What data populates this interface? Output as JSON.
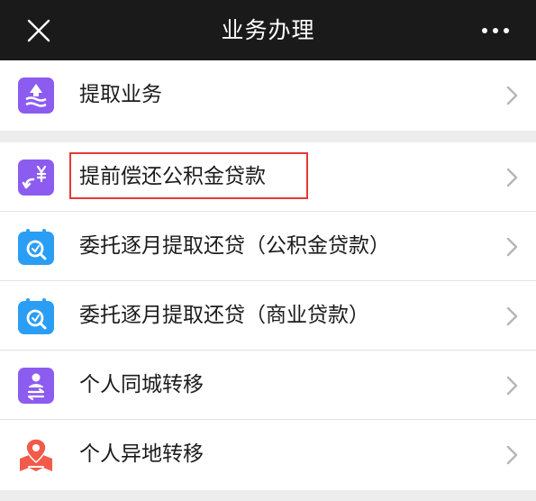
{
  "header": {
    "title": "业务办理"
  },
  "group1": [
    {
      "label": "提取业务",
      "icon": "withdraw-icon"
    }
  ],
  "group2": [
    {
      "label": "提前偿还公积金贷款",
      "icon": "loan-repay-icon"
    },
    {
      "label": "委托逐月提取还贷（公积金贷款）",
      "icon": "calendar-search-icon"
    },
    {
      "label": "委托逐月提取还贷（商业贷款）",
      "icon": "calendar-search-icon"
    },
    {
      "label": "个人同城转移",
      "icon": "person-transfer-icon"
    },
    {
      "label": "个人异地转移",
      "icon": "map-pin-transfer-icon"
    }
  ],
  "colors": {
    "header_bg": "#1a1a1a",
    "purple": "#8c5cf0",
    "blue": "#2a9df4",
    "red": "#f25a4a",
    "highlight": "#e53935"
  }
}
